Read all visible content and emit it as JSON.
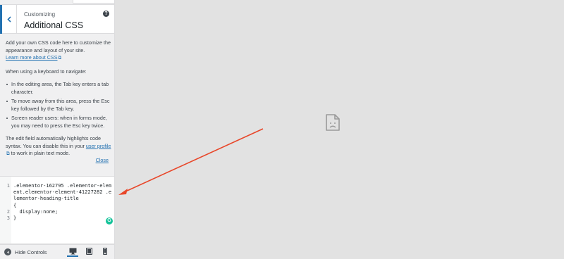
{
  "header": {
    "breadcrumb": "Customizing",
    "title": "Additional CSS",
    "help_icon": "?"
  },
  "description": {
    "intro": "Add your own CSS code here to customize the appearance and layout of your site.",
    "learn_more": "Learn more about CSS",
    "keyboard_heading": "When using a keyboard to navigate:",
    "bullets": [
      "In the editing area, the Tab key enters a tab character.",
      "To move away from this area, press the Esc key followed by the Tab key.",
      "Screen reader users: when in forms mode, you may need to press the Esc key twice."
    ],
    "edit_field_before": "The edit field automatically highlights code syntax. You can disable this in your ",
    "user_profile_link": "user profile",
    "edit_field_after": " to work in plain text mode.",
    "close_link": "Close"
  },
  "editor": {
    "lines": [
      {
        "num": "1",
        "text": ".elementor-162795 .elementor-element.elementor-element-41227282 .elementor-heading-title"
      },
      {
        "num": "",
        "text": "{"
      },
      {
        "num": "2",
        "text": "  display:none;"
      },
      {
        "num": "3",
        "text": "}"
      }
    ],
    "grammarly_badge": "G"
  },
  "footer": {
    "hide_controls": "Hide Controls",
    "devices": [
      "desktop-icon",
      "tablet-icon",
      "mobile-icon"
    ],
    "active_device": "desktop"
  },
  "preview": {
    "placeholder_icon": "broken-image-icon",
    "annotation_color": "#e8472a"
  },
  "colors": {
    "accent": "#2271b1",
    "sidebar_bg": "#f0f0f1",
    "preview_bg": "#e2e2e2"
  }
}
